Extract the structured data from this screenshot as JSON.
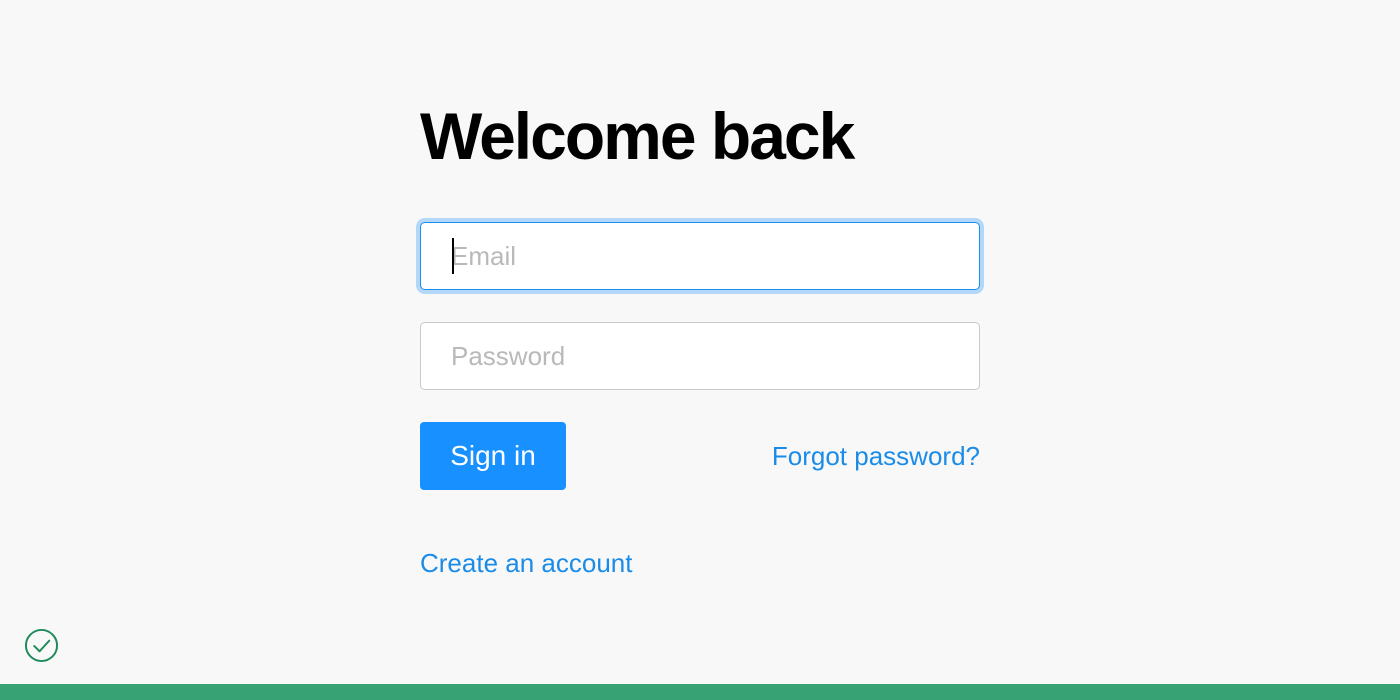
{
  "login": {
    "title": "Welcome back",
    "email_placeholder": "Email",
    "email_value": "",
    "password_placeholder": "Password",
    "password_value": "",
    "sign_in_label": "Sign in",
    "forgot_label": "Forgot password?",
    "create_account_label": "Create an account"
  },
  "status": {
    "icon": "check-circle-icon",
    "color": "#1e8a5a"
  },
  "colors": {
    "accent": "#1890ff",
    "link": "#1a8ce8",
    "bottom_bar": "#37a374",
    "background": "#f8f8f8"
  }
}
